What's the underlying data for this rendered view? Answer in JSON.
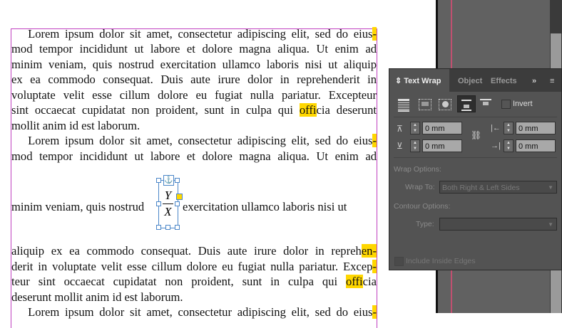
{
  "document": {
    "lines_before": [
      {
        "pre": "   Lorem ipsum dolor sit amet, consectetur adipiscing elit, sed do eius",
        "hl": "-",
        "post": "",
        "last": false
      },
      {
        "pre": "mod tempor incididunt ut labore et dolore magna aliqua. Ut enim ad",
        "hl": "",
        "post": "",
        "last": false
      },
      {
        "pre": "minim veniam, quis nostrud exercitation ullamco laboris nisi ut aliquip",
        "hl": "",
        "post": "",
        "last": false
      },
      {
        "pre": "ex ea commodo consequat. Duis aute irure dolor in reprehenderit in",
        "hl": "",
        "post": "",
        "last": false
      },
      {
        "pre": "voluptate velit esse cillum dolore eu fugiat nulla pariatur. Excepteur",
        "hl": "",
        "post": "",
        "last": false
      },
      {
        "pre": "sint occaecat cupidatat non proident, sunt in culpa qui ",
        "hl": "offi",
        "post": "cia deserunt",
        "last": false
      },
      {
        "pre": "mollit anim id est laborum.",
        "hl": "",
        "post": "",
        "last": true
      },
      {
        "pre": "   Lorem ipsum dolor sit amet, consectetur adipiscing elit, sed do eius",
        "hl": "-",
        "post": "",
        "last": false
      },
      {
        "pre": "mod tempor incididunt ut labore et dolore magna aliqua. Ut enim ad",
        "hl": "",
        "post": "",
        "last": false
      }
    ],
    "anchored_line_left": "minim veniam, quis nostrud",
    "anchored_line_right": "exercitation ullamco laboris nisi ut",
    "formula": {
      "numerator": "Y",
      "denominator": "X"
    },
    "lines_after": [
      {
        "pre": "aliquip ex ea commodo consequat. Duis aute irure dolor in repreh",
        "hl": "en-",
        "post": "",
        "last": false
      },
      {
        "pre": "derit in voluptate velit esse cillum dolore eu fugiat nulla pariatur. Excep",
        "hl": "-",
        "post": "",
        "last": false
      },
      {
        "pre": "teur sint occaecat cupidatat non proident, sunt in culpa qui ",
        "hl": "offi",
        "post": "cia",
        "last": false
      },
      {
        "pre": "deserunt mollit anim id est laborum.",
        "hl": "",
        "post": "",
        "last": true
      },
      {
        "pre": "   Lorem ipsum dolor sit amet, consectetur adipiscing elit, sed do eius",
        "hl": "-",
        "post": "",
        "last": false
      }
    ]
  },
  "panel": {
    "tabs": [
      "Text Wrap",
      "Object",
      "Effects"
    ],
    "invert_label": "Invert",
    "top_offset": "0 mm",
    "bottom_offset": "0 mm",
    "left_offset": "0 mm",
    "right_offset": "0 mm",
    "wrap_options_label": "Wrap Options:",
    "wrap_to_label": "Wrap To:",
    "wrap_to_value": "Both Right & Left Sides",
    "contour_options_label": "Contour Options:",
    "type_label": "Type:",
    "type_value": "",
    "include_inside_edges_label": "Include Inside Edges"
  },
  "colors": {
    "highlight": "#ffd700",
    "frame": "#c040c0",
    "selection": "#4a86c8"
  }
}
